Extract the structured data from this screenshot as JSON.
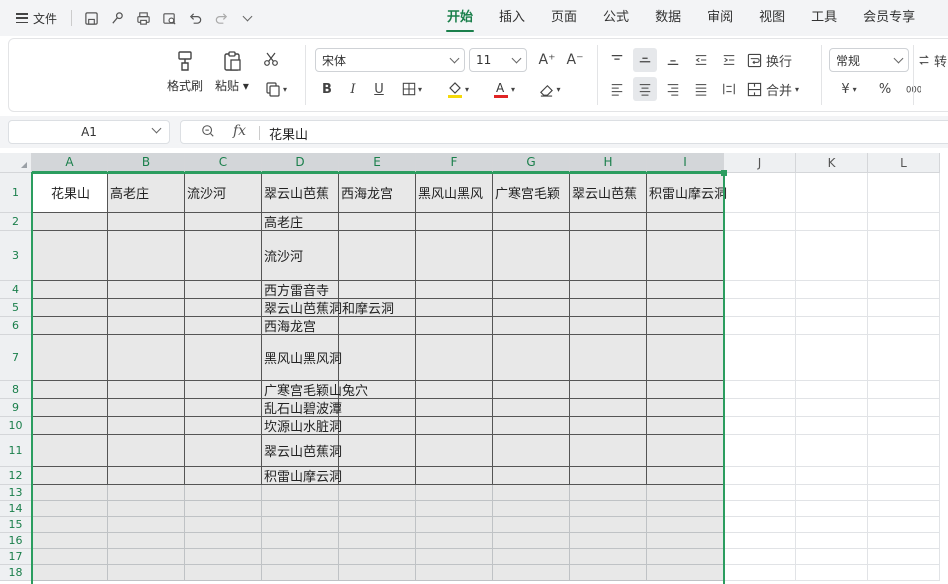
{
  "menu": {
    "file_label": "文件",
    "tabs": [
      "开始",
      "插入",
      "页面",
      "公式",
      "数据",
      "审阅",
      "视图",
      "工具",
      "会员专享"
    ],
    "active_tab_index": 0
  },
  "ribbon": {
    "format_painter": "格式刷",
    "paste": "粘贴",
    "font_name": "宋体",
    "font_size": "11",
    "wrap_text": "换行",
    "merge": "合并",
    "number_format": "常规",
    "currency_symbol": "¥",
    "percent_symbol": "%",
    "rotate_label": "转",
    "font_size_up": "A⁺",
    "font_size_down": "A⁻",
    "font_color": "#e02424",
    "fill_color": "#f5d90a"
  },
  "formula_bar": {
    "cell_ref": "A1",
    "fx_symbol": "fx",
    "value": "花果山"
  },
  "sheet": {
    "columns": [
      "A",
      "B",
      "C",
      "D",
      "E",
      "F",
      "G",
      "H",
      "I",
      "J",
      "K",
      "L"
    ],
    "row_numbers": [
      "1",
      "2",
      "3",
      "4",
      "5",
      "6",
      "7",
      "8",
      "9",
      "10",
      "11",
      "12",
      "13",
      "14",
      "15",
      "16",
      "17",
      "18"
    ],
    "row1": [
      "花果山",
      "高老庄",
      "流沙河",
      "翠云山芭蕉",
      "西海龙宫",
      "黑风山黑风",
      "广寒宫毛颖",
      "翠云山芭蕉",
      "积雷山摩云洞"
    ],
    "col_d": [
      "高老庄",
      "流沙河",
      "西方雷音寺",
      "翠云山芭蕉洞和摩云洞",
      "西海龙宫",
      "黑风山黑风洞",
      "广寒宫毛颖山兔穴",
      "乱石山碧波潭",
      "坎源山水脏洞",
      "翠云山芭蕉洞",
      "积雷山摩云洞"
    ]
  }
}
